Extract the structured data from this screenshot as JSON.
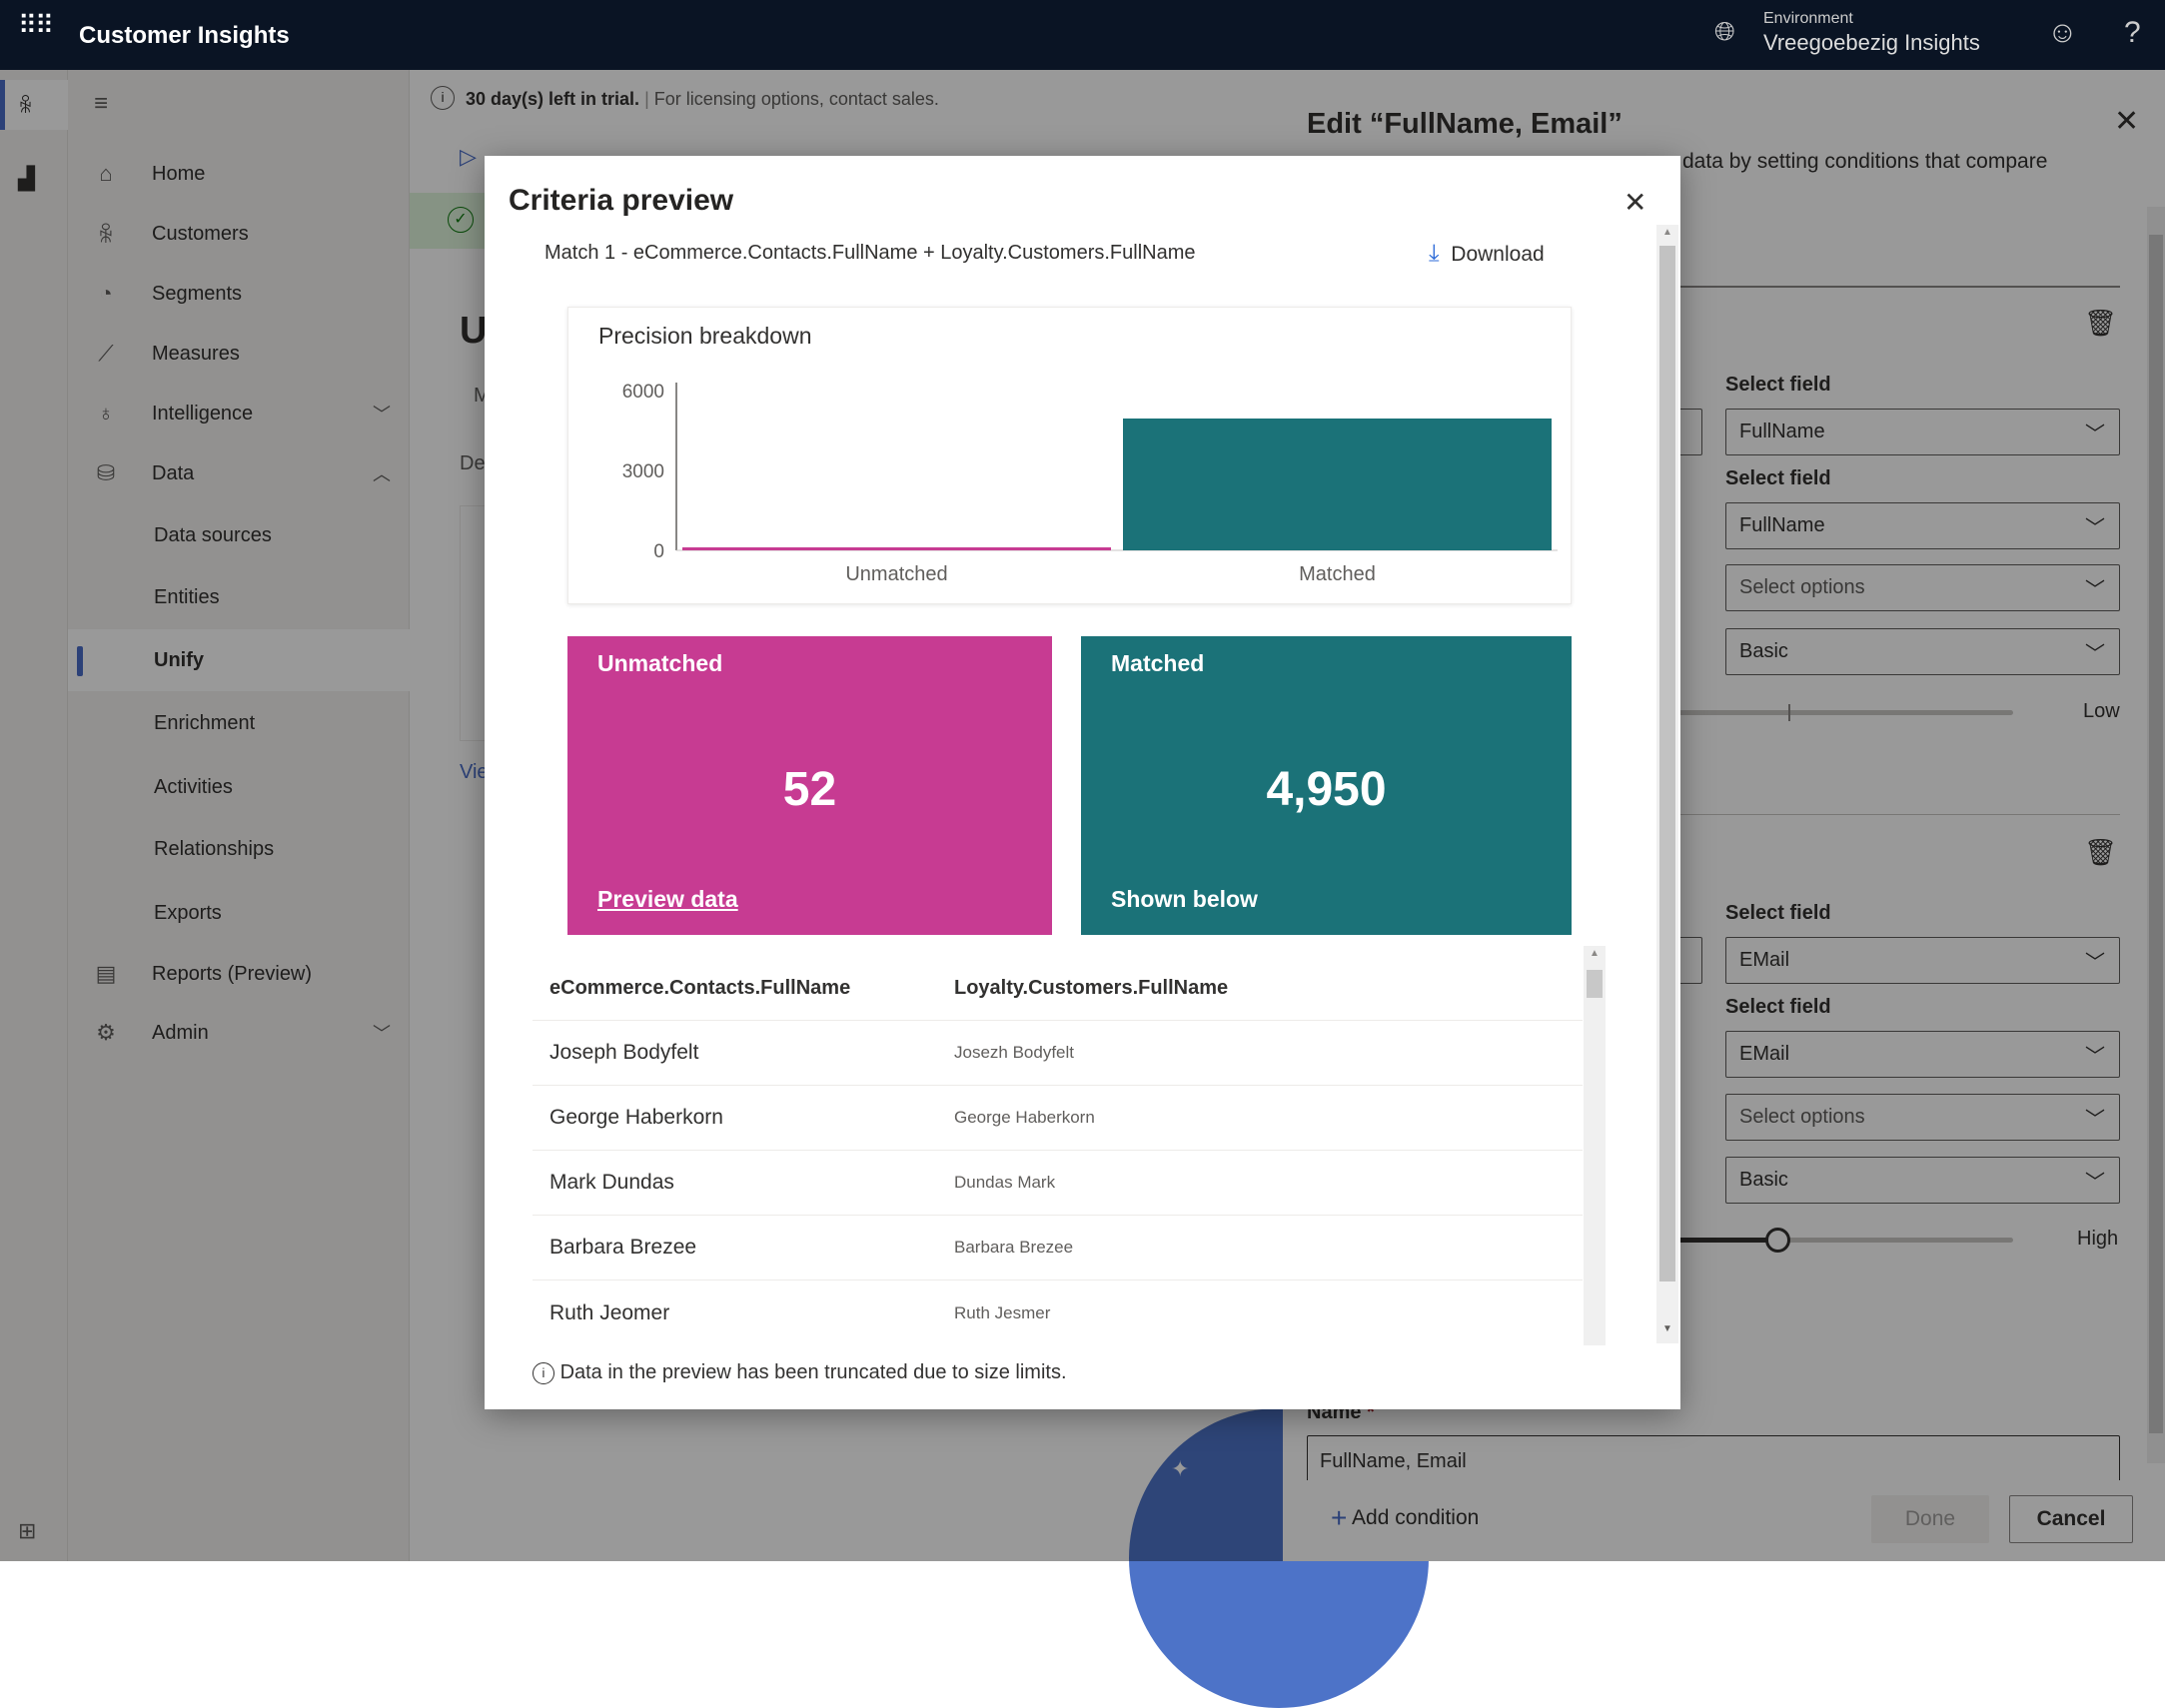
{
  "header": {
    "app_title": "Customer Insights",
    "environment_label": "Environment",
    "environment_name": "Vreegoebezig Insights"
  },
  "sidebar": {
    "items": [
      {
        "label": "Home",
        "icon": "home-icon"
      },
      {
        "label": "Customers",
        "icon": "people-icon"
      },
      {
        "label": "Segments",
        "icon": "pie-icon"
      },
      {
        "label": "Measures",
        "icon": "chart-line-icon"
      },
      {
        "label": "Intelligence",
        "icon": "lightbulb-icon",
        "chevron": "down"
      },
      {
        "label": "Data",
        "icon": "database-icon",
        "chevron": "up"
      },
      {
        "label": "Data sources"
      },
      {
        "label": "Entities"
      },
      {
        "label": "Unify",
        "selected": true
      },
      {
        "label": "Enrichment"
      },
      {
        "label": "Activities"
      },
      {
        "label": "Relationships"
      },
      {
        "label": "Exports"
      },
      {
        "label": "Reports (Preview)",
        "icon": "report-icon"
      },
      {
        "label": "Admin",
        "icon": "gear-icon",
        "chevron": "down"
      }
    ]
  },
  "main": {
    "trial_bold": "30 day(s) left in trial.",
    "trial_text": "For licensing options, contact sales.",
    "fragment_title": "U",
    "fragment_m": "M",
    "fragment_de": "De",
    "fragment_view": "Vie"
  },
  "panel": {
    "title": "Edit “FullName, Email”",
    "description_visible": "data by setting conditions that compare",
    "conditions": [
      {
        "field1_label": "Select field",
        "field1": "FullName",
        "field2_label": "Select field",
        "field2": "FullName",
        "options": "Select options",
        "normalization": "Basic",
        "precision_label": "Low",
        "precision_level": 0.33
      },
      {
        "field1_label": "Select field",
        "field1": "EMail",
        "field2_label": "Select field",
        "field2": "EMail",
        "options": "Select options",
        "normalization": "Basic",
        "precision_label": "High",
        "precision_level": 0.3
      }
    ],
    "name_label": "Name",
    "name_value": "FullName, Email",
    "add_condition": "Add condition",
    "done": "Done",
    "cancel": "Cancel"
  },
  "dialog": {
    "title": "Criteria preview",
    "match_text": "Match 1 - eCommerce.Contacts.FullName + Loyalty.Customers.FullName",
    "download": "Download",
    "unmatched_title": "Unmatched",
    "unmatched_value": "52",
    "unmatched_link": "Preview data",
    "matched_title": "Matched",
    "matched_value": "4,950",
    "matched_note": "Shown below",
    "colors": {
      "unmatched": "#c73b92",
      "matched": "#1b7278"
    },
    "table": {
      "headers": [
        "eCommerce.Contacts.FullName",
        "Loyalty.Customers.FullName"
      ],
      "rows": [
        [
          "Joseph Bodyfelt",
          "Josezh Bodyfelt"
        ],
        [
          "George Haberkorn",
          "George Haberkorn"
        ],
        [
          "Mark Dundas",
          "Dundas Mark"
        ],
        [
          "Barbara Brezee",
          "Barbara Brezee"
        ],
        [
          "Ruth Jeomer",
          "Ruth Jesmer"
        ]
      ]
    },
    "footnote": "Data in the preview has been truncated due to size limits."
  },
  "chart_data": {
    "type": "bar",
    "title": "Precision breakdown",
    "categories": [
      "Unmatched",
      "Matched"
    ],
    "values": [
      52,
      4950
    ],
    "colors": [
      "#c73b92",
      "#1b7278"
    ],
    "ylim": [
      0,
      6000
    ],
    "yticks": [
      "6000",
      "3000",
      "0"
    ],
    "xlabel": "",
    "ylabel": "",
    "grid": false
  }
}
